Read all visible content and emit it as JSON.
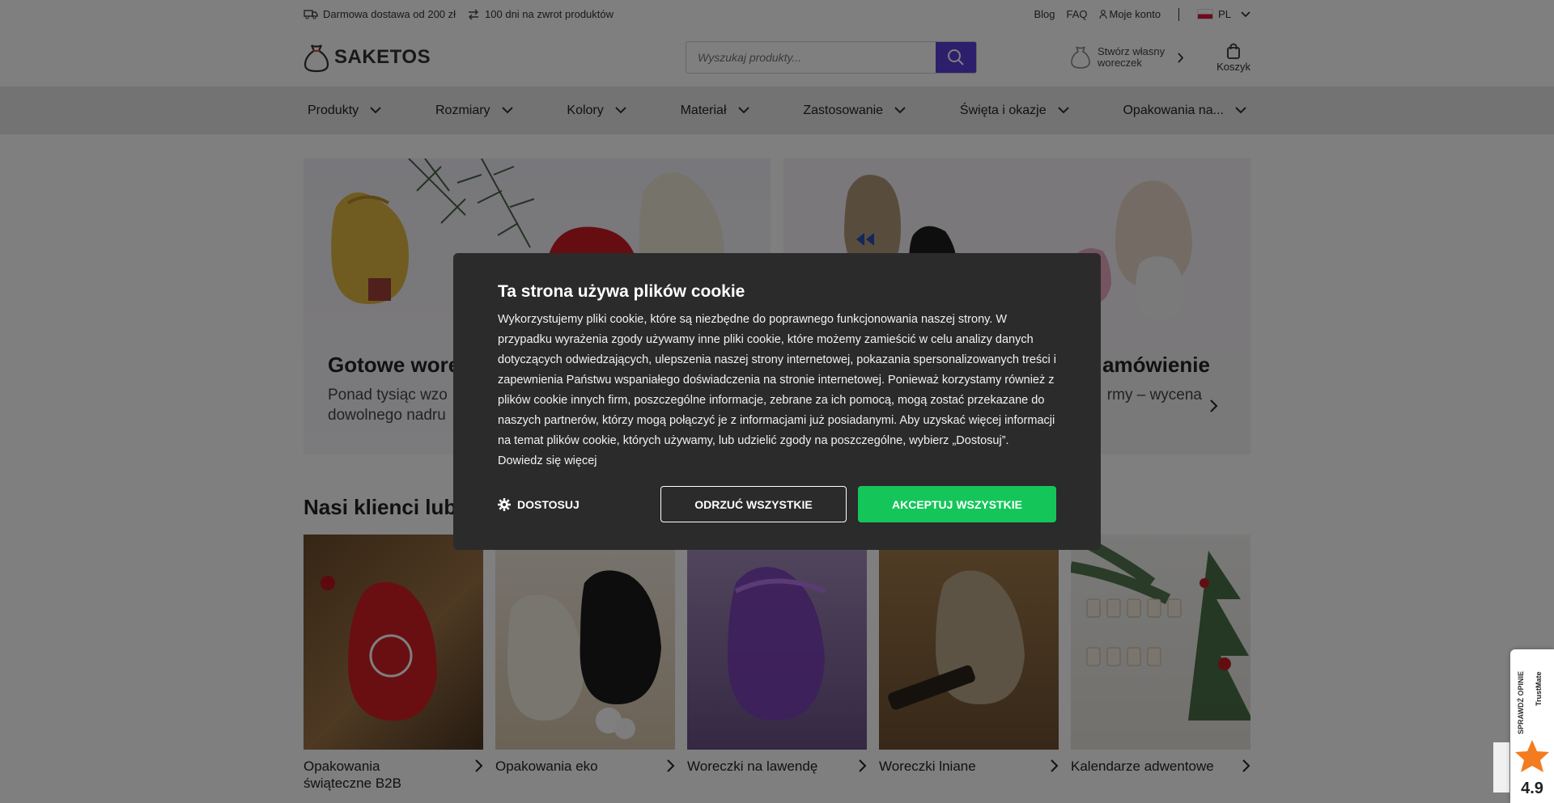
{
  "topbar": {
    "shipping": "Darmowa dostawa od 200 zł",
    "returns": "100 dni na zwrot produktów",
    "blog": "Blog",
    "faq": "FAQ",
    "account": "Moje konto",
    "language": "PL"
  },
  "header": {
    "logo": "SAKETOS",
    "search_placeholder": "Wyszukaj produkty...",
    "create_line1": "Stwórz własny",
    "create_line2": "woreczek",
    "cart": "Koszyk"
  },
  "nav": [
    "Produkty",
    "Rozmiary",
    "Kolory",
    "Materiał",
    "Zastosowanie",
    "Święta i okazje",
    "Opakowania na..."
  ],
  "hero": {
    "left_title": "Gotowe wore",
    "left_desc_1": "Ponad tysiąc wzo",
    "left_desc_2": "dowolnego nadru",
    "right_title": "amówienie",
    "right_desc": "rmy – wycena"
  },
  "section": {
    "title": "Nasi klienci lub",
    "items": [
      {
        "line1": "Opakowania",
        "line2": "świąteczne B2B"
      },
      {
        "line1": "Opakowania eko",
        "line2": ""
      },
      {
        "line1": "Woreczki na lawendę",
        "line2": ""
      },
      {
        "line1": "Woreczki lniane",
        "line2": ""
      },
      {
        "line1": "Kalendarze adwentowe",
        "line2": ""
      }
    ]
  },
  "cookie": {
    "title": "Ta strona używa plików cookie",
    "text": "Wykorzystujemy pliki cookie, które są niezbędne do poprawnego funkcjonowania naszej strony. W przypadku wyrażenia zgody używamy inne pliki cookie, które możemy zamieścić w celu analizy danych dotyczących odwiedzających, ulepszenia naszej strony internetowej, pokazania spersonalizowanych treści i zapewnienia Państwu wspaniałego doświadczenia na stronie internetowej. Ponieważ korzystamy również z plików cookie innych firm, poszczególne informacje, zebrane za ich pomocą, mogą zostać przekazane do naszych partnerów, którzy mogą połączyć je z informacjami już posiadanymi. Aby uzyskać więcej informacji na temat plików cookie, których używamy, lub udzielić zgody na poszczególne, wybierz „Dostosuj”. Dowiedz się więcej",
    "customize": "DOSTOSUJ",
    "reject": "ODRZUĆ WSZYSTKIE",
    "accept": "AKCEPTUJ WSZYSTKIE"
  },
  "trust": {
    "label": "SPRAWDŹ OPINIE",
    "brand": "TrustMate",
    "score": "4.9"
  },
  "colors": {
    "accent": "#5b3fd6",
    "accept": "#14c65a",
    "modal_bg": "#2b2b2b"
  }
}
